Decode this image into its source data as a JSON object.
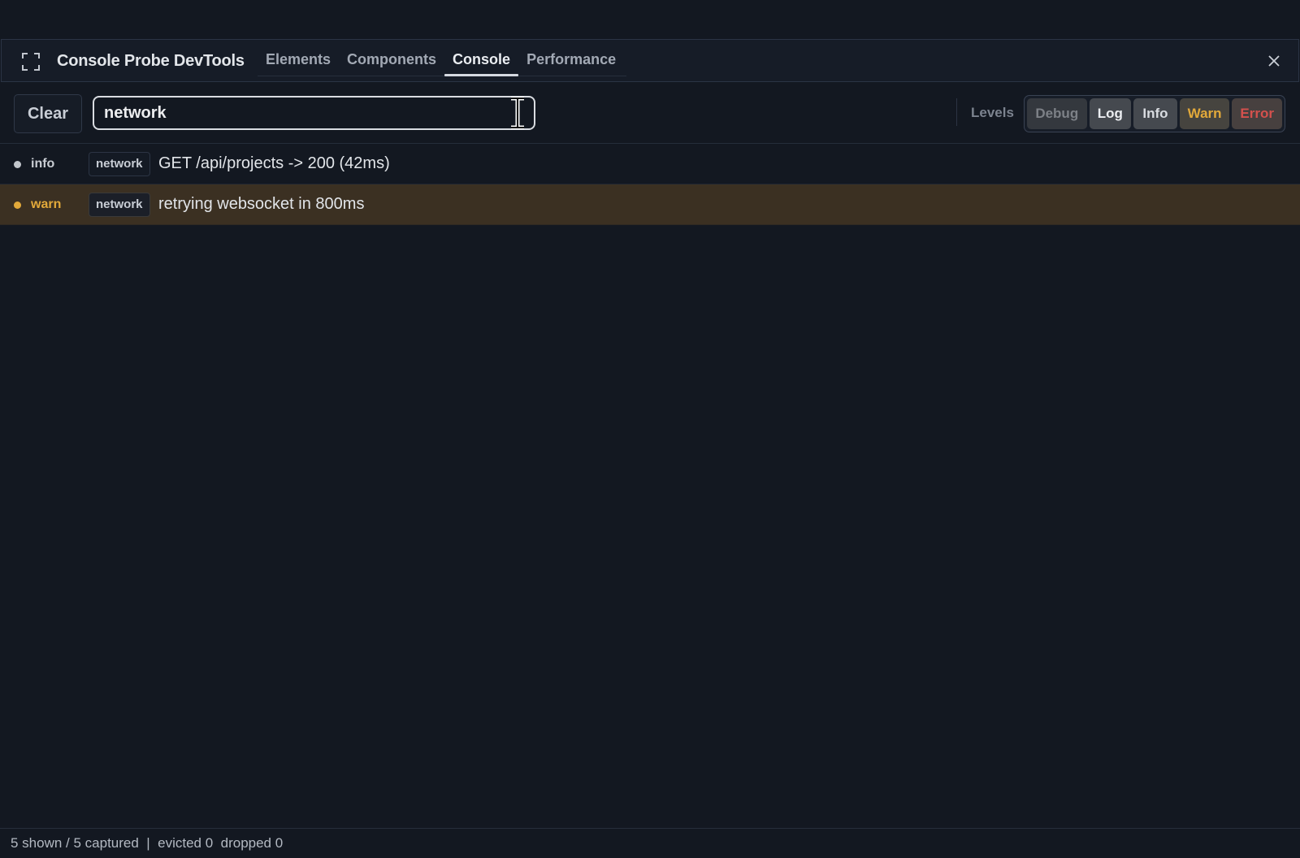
{
  "header": {
    "title": "Console Probe DevTools",
    "expand_icon": "expand-icon",
    "close_icon": "close-icon",
    "tabs": [
      {
        "label": "Elements",
        "active": false
      },
      {
        "label": "Components",
        "active": false
      },
      {
        "label": "Console",
        "active": true
      },
      {
        "label": "Performance",
        "active": false
      }
    ]
  },
  "toolbar": {
    "clear_label": "Clear",
    "filter_value": "network",
    "levels_label": "Levels",
    "levels": [
      {
        "label": "Debug",
        "enabled": false,
        "color": "#7d8187"
      },
      {
        "label": "Log",
        "enabled": true,
        "color": "#eceef1"
      },
      {
        "label": "Info",
        "enabled": true,
        "color": "#d9dce1"
      },
      {
        "label": "Warn",
        "enabled": true,
        "color": "#e2a93a"
      },
      {
        "label": "Error",
        "enabled": true,
        "color": "#d4514d"
      }
    ]
  },
  "logs": [
    {
      "level": "info",
      "level_color": "#c2c6cc",
      "tag": "network",
      "message": "GET /api/projects -> 200 (42ms)"
    },
    {
      "level": "warn",
      "level_color": "#e2a93a",
      "tag": "network",
      "message": "retrying websocket in 800ms"
    }
  ],
  "footer": {
    "status": "5 shown / 5 captured  |  evicted 0  dropped 0"
  },
  "colors": {
    "background": "#131821",
    "warn_row_bg": "#3b3022",
    "accent_warn": "#e2a93a",
    "accent_error": "#d4514d"
  }
}
